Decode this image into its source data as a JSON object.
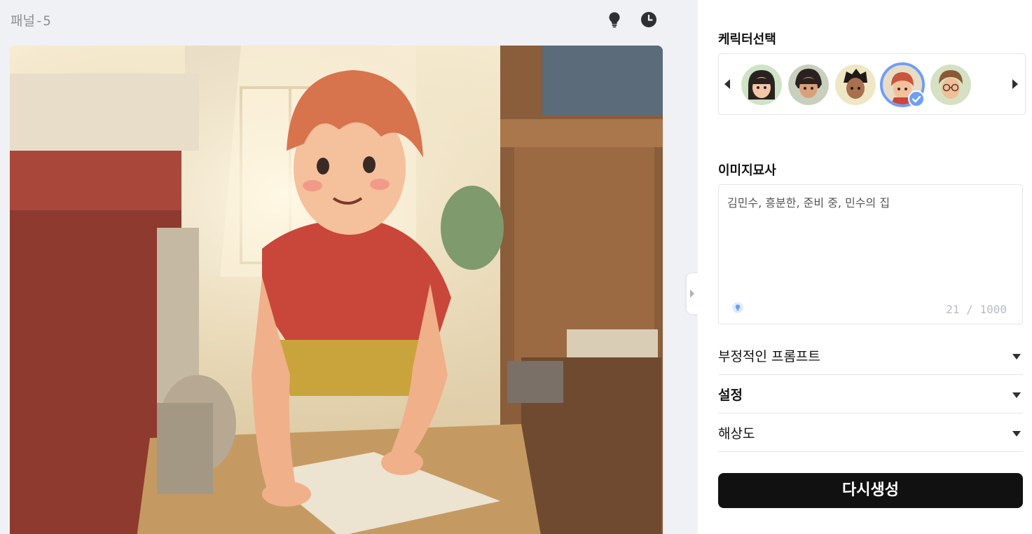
{
  "panel": {
    "title": "패널-5"
  },
  "toolbar": {
    "hint_icon": "lightbulb-icon",
    "history_icon": "clock-icon"
  },
  "sidebar": {
    "character_select": {
      "label": "케릭터선택",
      "characters": [
        {
          "name": "girl-black-hair-bangs",
          "selected": false
        },
        {
          "name": "girl-black-hair-short",
          "selected": false
        },
        {
          "name": "boy-black-messy-hair",
          "selected": false
        },
        {
          "name": "boy-red-hair",
          "selected": true
        },
        {
          "name": "boy-brown-hair-glasses",
          "selected": false
        }
      ]
    },
    "image_description": {
      "label": "이미지묘사",
      "value": "김민수, 흥분한, 준비 중, 민수의 집",
      "count": "21 / 1000"
    },
    "sections": {
      "negative_prompt": "부정적인 프롬프트",
      "settings": "설정",
      "resolution": "해상도"
    },
    "regenerate_label": "다시생성"
  },
  "colors": {
    "accent": "#6f9ef5",
    "button_bg": "#111111",
    "panel_bg": "#f0f1f5"
  }
}
